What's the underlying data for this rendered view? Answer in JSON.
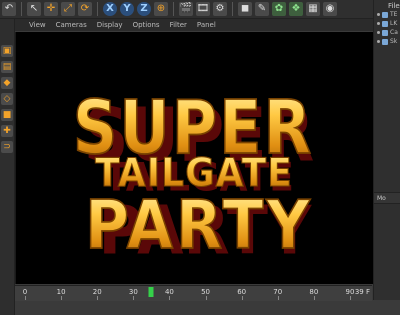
{
  "toolbar": {
    "tools": [
      {
        "name": "undo",
        "glyph": "↶"
      },
      {
        "name": "select",
        "glyph": "↖"
      },
      {
        "name": "move",
        "glyph": "✛"
      },
      {
        "name": "scale",
        "glyph": "⤢"
      },
      {
        "name": "rotate",
        "glyph": "⟳"
      }
    ],
    "axes": [
      "X",
      "Y",
      "Z"
    ]
  },
  "viewport_menu": {
    "items": [
      "View",
      "Cameras",
      "Display",
      "Options",
      "Filter",
      "Panel"
    ]
  },
  "viewport": {
    "lines": [
      "SUPER",
      "TAILGATE",
      "PARTY"
    ]
  },
  "timeline": {
    "ticks": [
      "0",
      "10",
      "20",
      "30",
      "40",
      "50",
      "60",
      "70",
      "80",
      "90"
    ],
    "current_frame": 35,
    "frame_max": 90,
    "frame_readout": "39 F"
  },
  "object_manager": {
    "header": "File",
    "objects": [
      "TE",
      "LK",
      "Ca",
      "Sk"
    ]
  },
  "attributes": {
    "header": "Mo"
  },
  "colors": {
    "gold_light": "#ffd36a",
    "gold_dark": "#b8700a",
    "extrude_red": "#7a0f0f",
    "playhead": "#35d14a"
  }
}
